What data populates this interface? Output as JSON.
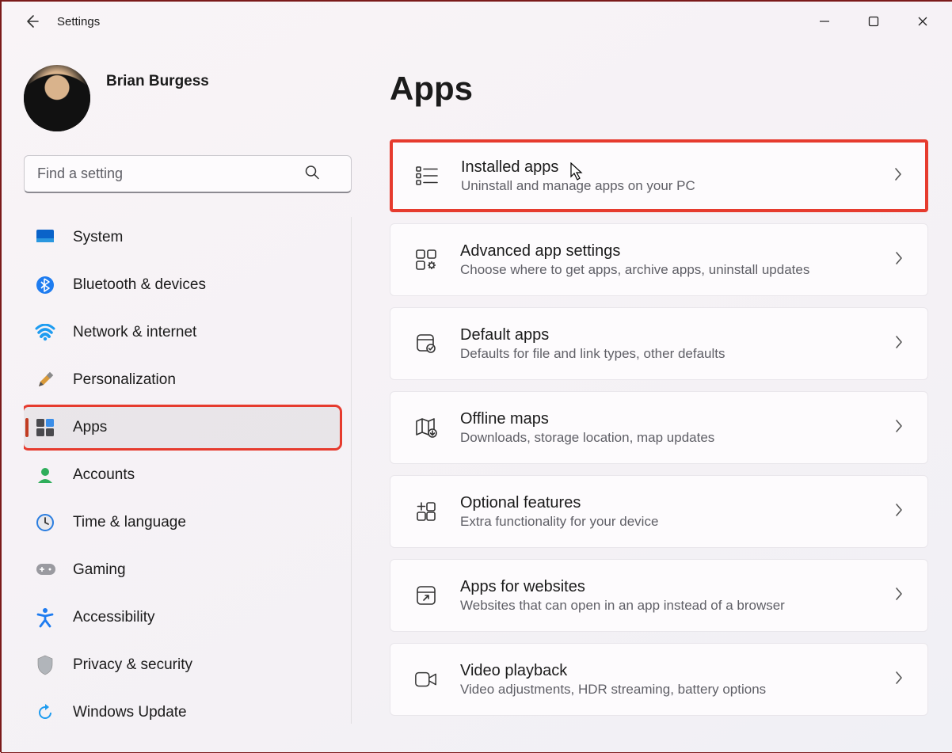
{
  "app": {
    "title": "Settings"
  },
  "user": {
    "name": "Brian Burgess"
  },
  "search": {
    "placeholder": "Find a setting"
  },
  "sidebar": {
    "items": [
      {
        "icon": "system",
        "label": "System",
        "selected": false
      },
      {
        "icon": "bluetooth",
        "label": "Bluetooth & devices",
        "selected": false
      },
      {
        "icon": "network",
        "label": "Network & internet",
        "selected": false
      },
      {
        "icon": "personalization",
        "label": "Personalization",
        "selected": false
      },
      {
        "icon": "apps",
        "label": "Apps",
        "selected": true
      },
      {
        "icon": "accounts",
        "label": "Accounts",
        "selected": false
      },
      {
        "icon": "time",
        "label": "Time & language",
        "selected": false
      },
      {
        "icon": "gaming",
        "label": "Gaming",
        "selected": false
      },
      {
        "icon": "accessibility",
        "label": "Accessibility",
        "selected": false
      },
      {
        "icon": "privacy",
        "label": "Privacy & security",
        "selected": false
      },
      {
        "icon": "update",
        "label": "Windows Update",
        "selected": false
      }
    ]
  },
  "page": {
    "title": "Apps",
    "cards": [
      {
        "icon": "installed",
        "title": "Installed apps",
        "desc": "Uninstall and manage apps on your PC",
        "highlighted": true
      },
      {
        "icon": "advanced",
        "title": "Advanced app settings",
        "desc": "Choose where to get apps, archive apps, uninstall updates"
      },
      {
        "icon": "default",
        "title": "Default apps",
        "desc": "Defaults for file and link types, other defaults"
      },
      {
        "icon": "maps",
        "title": "Offline maps",
        "desc": "Downloads, storage location, map updates"
      },
      {
        "icon": "optional",
        "title": "Optional features",
        "desc": "Extra functionality for your device"
      },
      {
        "icon": "websites",
        "title": "Apps for websites",
        "desc": "Websites that can open in an app instead of a browser"
      },
      {
        "icon": "video",
        "title": "Video playback",
        "desc": "Video adjustments, HDR streaming, battery options"
      }
    ]
  }
}
